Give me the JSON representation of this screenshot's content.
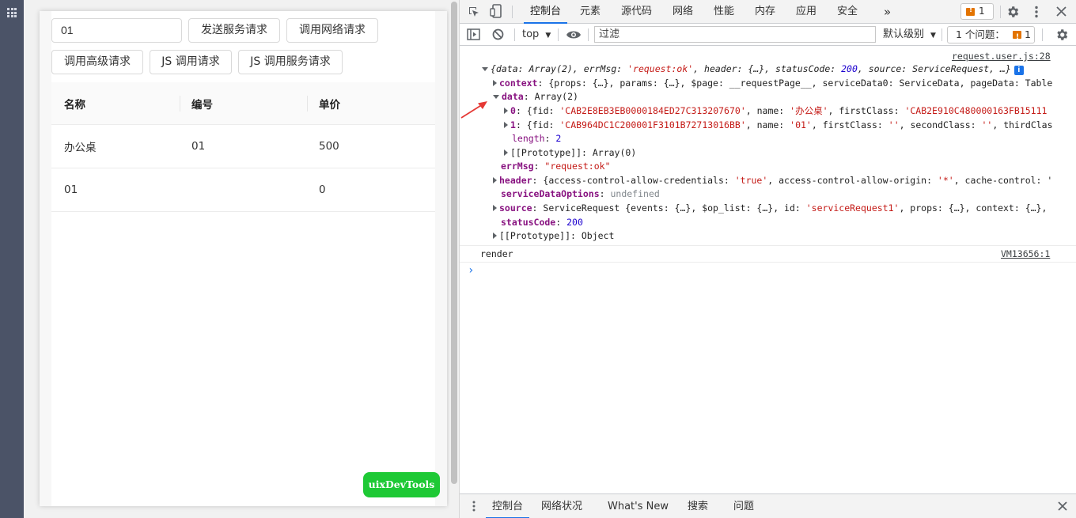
{
  "app": {
    "input_value": "01",
    "buttons": [
      "发送服务请求",
      "调用网络请求",
      "调用高级请求",
      "JS 调用请求",
      "JS 调用服务请求"
    ],
    "table": {
      "headers": [
        "名称",
        "编号",
        "单价"
      ],
      "rows": [
        [
          "办公桌",
          "01",
          "500"
        ],
        [
          "01",
          "",
          "0"
        ]
      ]
    },
    "uix_label": "uixDevTools"
  },
  "devtools": {
    "tabs": [
      "控制台",
      "元素",
      "源代码",
      "网络",
      "性能",
      "内存",
      "应用",
      "安全"
    ],
    "more_tabs": "»",
    "issues_count": "1",
    "context": "top",
    "filter_placeholder": "过滤",
    "levels": "默认级别",
    "issues_label": "1 个问题：",
    "issues_badge": "1",
    "console": {
      "src1": "request.user.js:28",
      "line0_open": "{data: Array(2), errMsg: ",
      "line0_errmsg": "'request:ok'",
      "line0_mid": ", header: {…}, statusCode: ",
      "line0_code": "200",
      "line0_end": ", source: ServiceRequest, …}",
      "context_key": "context",
      "context_val": "{props: {…}, params: {…}, $page: __requestPage__, serviceData0: ServiceData, pageData: Table",
      "data_key": "data",
      "data_val": "Array(2)",
      "item0_key": "0",
      "item0_a": "{fid: ",
      "item0_fid": "'CAB2E8EB3EB0000184ED27C313207670'",
      "item0_b": ", name: ",
      "item0_name": "'办公桌'",
      "item0_c": ", firstClass: ",
      "item0_fc": "'CAB2E910C480000163FB15111",
      "item1_key": "1",
      "item1_a": "{fid: ",
      "item1_fid": "'CAB964DC1C200001F3101B72713016BB'",
      "item1_b": ", name: ",
      "item1_name": "'01'",
      "item1_c": ", firstClass: ",
      "item1_fc": "''",
      "item1_d": ", secondClass: ",
      "item1_sc": "''",
      "item1_e": ", thirdClas",
      "length_key": "length",
      "length_val": "2",
      "proto1": "[[Prototype]]: Array(0)",
      "errmsg_key": "errMsg",
      "errmsg_val": "\"request:ok\"",
      "header_key": "header",
      "header_a": "{access-control-allow-credentials: ",
      "header_t": "'true'",
      "header_b": ", access-control-allow-origin: ",
      "header_star": "'*'",
      "header_c": ", cache-control: '",
      "sdo_key": "serviceDataOptions",
      "sdo_val": "undefined",
      "source_key": "source",
      "source_a": "ServiceRequest {events: {…}, $op_list: {…}, id: ",
      "source_id": "'serviceRequest1'",
      "source_b": ", props: {…}, context: {…},",
      "status_key": "statusCode",
      "status_val": "200",
      "proto2": "[[Prototype]]: Object",
      "render": "render",
      "src2": "VM13656:1",
      "prompt": "›"
    },
    "bottom_tabs": [
      "控制台",
      "网络状况",
      "What's New",
      "搜索",
      "问题"
    ]
  },
  "colors": {
    "accent": "#1a73e8",
    "uix_green": "#1ec935",
    "rail": "#4b5367"
  },
  "icons": [
    "apps-grid-icon",
    "inspect-icon",
    "device-toggle-icon",
    "gear-icon",
    "kebab-icon",
    "close-icon",
    "sidebar-toggle-icon",
    "clear-icon",
    "eye-icon",
    "info-icon",
    "drawer-menu-icon",
    "red-arrow-annotation"
  ]
}
